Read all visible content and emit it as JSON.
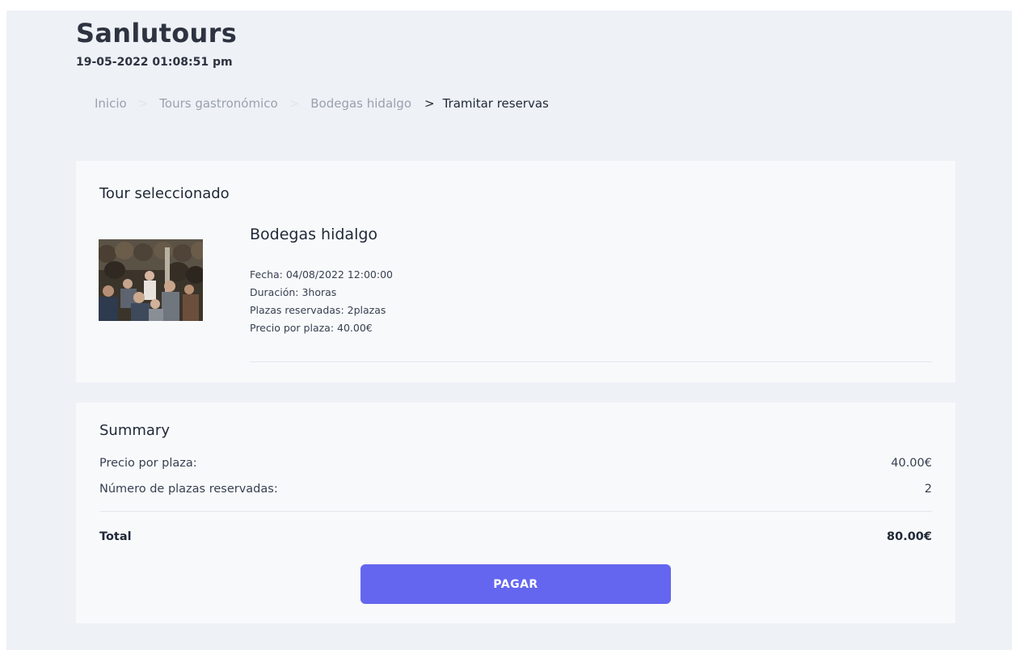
{
  "header": {
    "app_title": "Sanlutours",
    "datetime": "19-05-2022 01:08:51 pm"
  },
  "breadcrumb": {
    "items": [
      "Inicio",
      "Tours gastronómico",
      "Bodegas hidalgo"
    ],
    "separator": ">",
    "current": "Tramitar reservas"
  },
  "tour_card": {
    "title": "Tour seleccionado",
    "image_alt": "Bodegas hidalgo",
    "tour_name": "Bodegas hidalgo",
    "fecha": "Fecha: 04/08/2022 12:00:00",
    "duracion": "Duración: 3horas",
    "plazas": "Plazas reservadas: 2plazas",
    "precio": "Precio por plaza: 40.00€"
  },
  "summary": {
    "title": "Summary",
    "price_label": "Precio por plaza:",
    "price_value": "40.00€",
    "count_label": "Número de plazas reservadas:",
    "count_value": "2",
    "total_label": "Total",
    "total_value": "80.00€",
    "pay_label": "PAGAR"
  },
  "colors": {
    "page_background": "#eef1f6",
    "card_background": "#f8f9fb",
    "primary_button": "#6466ef",
    "text_dark": "#1f2937",
    "breadcrumb_muted": "#9aa1ad"
  }
}
